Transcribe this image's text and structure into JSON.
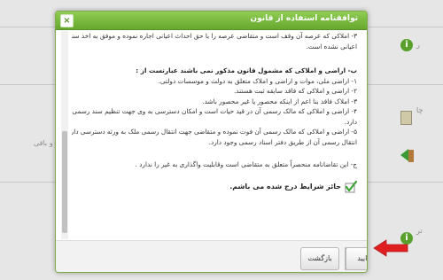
{
  "dialog": {
    "title": "توافقنامه استفاده از قانون",
    "close_label": "×",
    "content": {
      "lines_a": [
        "۳- املاکی که عرصه آن وقف است و متقاضی عرصه را با حق احداث اعیانی اجاره نموده و موفق به اخذ سند مالکیت",
        "اعیانی نشده است."
      ],
      "heading_b": "ب- اراضی و املاکی که مشمول قانون مذکور نمی باشند عبارتست از :",
      "lines_b": [
        "۱- اراضی ملی، موات و اراضی و املاک متعلق به دولت و موسسات دولتی.",
        "۲- اراضی و املاکی که فاقد سابقه ثبت هستند.",
        "۳- املاک فاقد بنا اعم از اینکه محصور یا غیر محصور باشد.",
        "۴- اراضی و املاکی که مالک رسمی آن در قید حیات است و امکان دسترسی به وی جهت تنظیم سند رسمی وجود",
        "دارد.",
        "۵- اراضی و املاکی که مالک رسمی آن فوت نموده و متقاضی جهت انتقال رسمی ملک به ورثه دسترسی دارد وامکان",
        "انتقال رسمی آن از طریق دفتر اسناد رسمی وجود دارد."
      ],
      "line_c": "ج- این تقاضانامه منحصراً متعلق به متقاضی است وقابلیت واگذاری به غیر را ندارد .",
      "agree_text": "حائز شرایط درج شده می باشم."
    },
    "buttons": {
      "confirm": "تایید",
      "back": "بازگشت"
    }
  },
  "background": {
    "left_text_1": "ری و باقی",
    "right_text_1": "ر",
    "right_text_2": "چا",
    "right_text_3": "تر"
  },
  "colors": {
    "titlebar": "#7bbb3f",
    "accent_red": "#e02020",
    "check_green": "#3aa535"
  }
}
